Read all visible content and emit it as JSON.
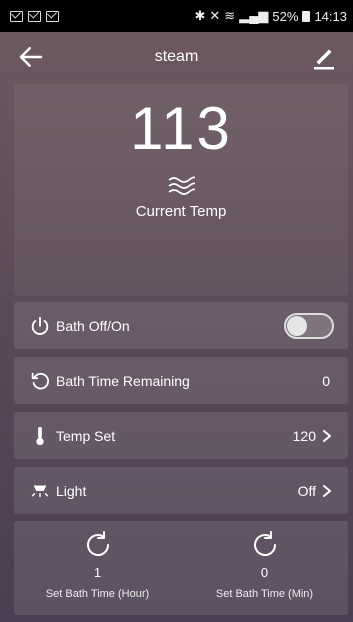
{
  "status_bar": {
    "left_icons": [
      "mail-icon",
      "mail-icon",
      "mail-icon"
    ],
    "right_text": "52%",
    "time": "14:13",
    "right_icons": [
      "bluetooth-icon",
      "mute-icon",
      "wifi-icon",
      "signal-icon",
      "battery-icon"
    ]
  },
  "app_bar": {
    "title": "steam",
    "back_icon": "back-arrow-icon",
    "edit_icon": "edit-pencil-icon"
  },
  "hero": {
    "temperature": "113",
    "icon": "steam-wave-icon",
    "label": "Current Temp"
  },
  "rows": [
    {
      "label": "Bath Off/On",
      "icon": "power-icon",
      "control": "toggle",
      "toggle_on": false
    },
    {
      "label": "Bath Time Remaining",
      "icon": "restart-icon",
      "value": "0"
    },
    {
      "label": "Temp Set",
      "icon": "thermometer-icon",
      "value": "120",
      "chevron": true
    },
    {
      "label": "Light",
      "icon": "lamp-icon",
      "value": "Off",
      "chevron": true
    }
  ],
  "bottom": {
    "hour": {
      "value": "1",
      "label": "Set Bath Time (Hour)",
      "icon": "refresh-icon"
    },
    "min": {
      "value": "0",
      "label": "Set Bath Time (Min)",
      "icon": "refresh-icon"
    }
  },
  "colors": {
    "background_top": "#6f5a62",
    "background_bottom": "#4a3e52",
    "text": "#ffffff"
  }
}
